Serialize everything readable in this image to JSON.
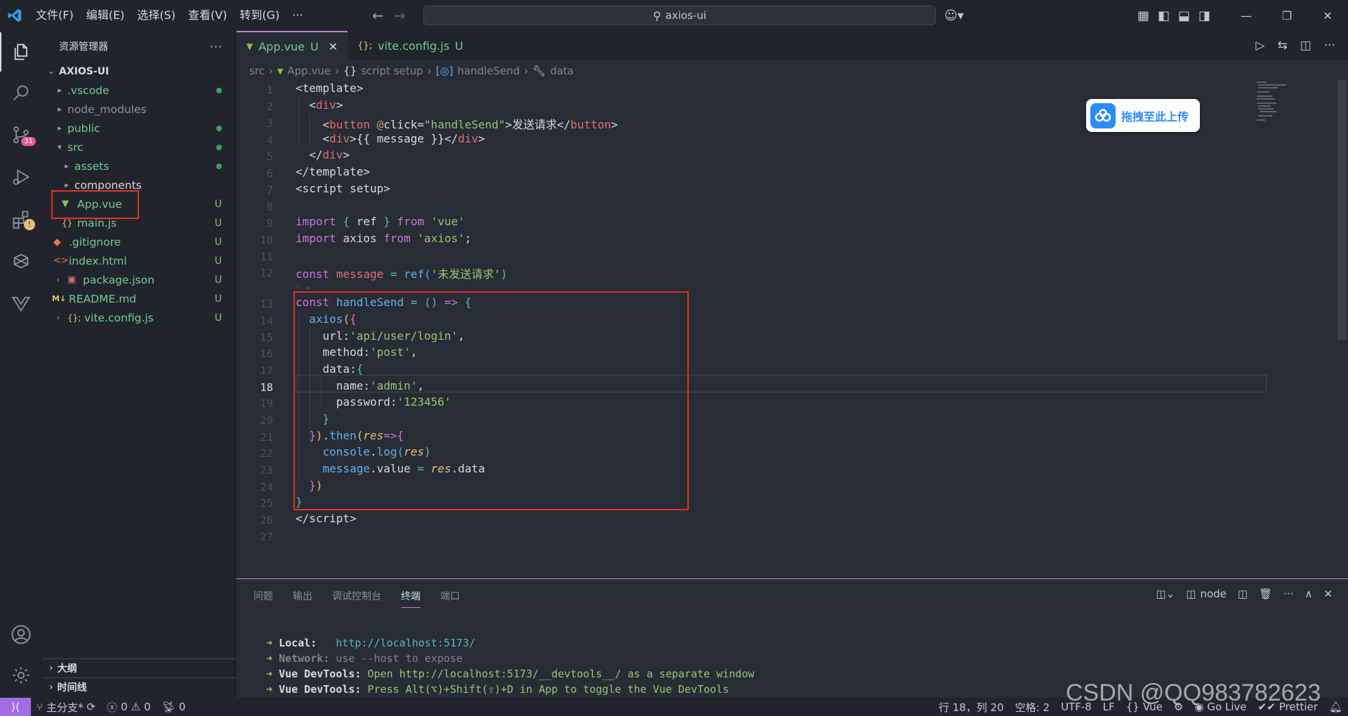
{
  "titlebar": {
    "menus": [
      "文件(F)",
      "编辑(E)",
      "选择(S)",
      "查看(V)",
      "转到(G)",
      "···"
    ],
    "search_text": "axios-ui"
  },
  "activity": {
    "source_control_badge": "31"
  },
  "sidebar": {
    "title": "资源管理器",
    "project": "AXIOS-UI",
    "items": [
      {
        "label": ".vscode",
        "status": "dot"
      },
      {
        "label": "node_modules",
        "status": ""
      },
      {
        "label": "public",
        "status": "dot"
      },
      {
        "label": "src",
        "status": "dot"
      },
      {
        "label": "assets",
        "status": "dot"
      },
      {
        "label": "components",
        "status": ""
      },
      {
        "label": "App.vue",
        "status": "U"
      },
      {
        "label": "main.js",
        "status": "U"
      },
      {
        "label": ".gitignore",
        "status": "U"
      },
      {
        "label": "index.html",
        "status": "U"
      },
      {
        "label": "package.json",
        "status": "U"
      },
      {
        "label": "README.md",
        "status": "U"
      },
      {
        "label": "vite.config.js",
        "status": "U"
      }
    ],
    "outline": "大纲",
    "timeline": "时间线"
  },
  "tabs": [
    {
      "label": "App.vue",
      "status": "U"
    },
    {
      "label": "vite.config.js",
      "status": "U"
    }
  ],
  "breadcrumb": [
    "src",
    "App.vue",
    "script setup",
    "handleSend",
    "data"
  ],
  "upload_badge": "拖拽至此上传",
  "editor": {
    "line_numbers": [
      "1",
      "2",
      "3",
      "4",
      "5",
      "6",
      "7",
      "8",
      "9",
      "10",
      "11",
      "12",
      "13",
      "14",
      "15",
      "16",
      "17",
      "18",
      "19",
      "20",
      "21",
      "22",
      "23",
      "24",
      "25",
      "26",
      "27"
    ],
    "current_line": "18"
  },
  "panel": {
    "tabs": [
      "问题",
      "输出",
      "调试控制台",
      "终端",
      "端口"
    ],
    "terminal_name": "node",
    "lines": [
      {
        "arrow": "➜",
        "label": "Local:",
        "text": "http://localhost:5173/"
      },
      {
        "arrow": "➜",
        "label": "Network:",
        "text": "use --host to expose"
      },
      {
        "arrow": "➜",
        "label": "Vue DevTools:",
        "text": "Open http://localhost:5173/__devtools__/ as a separate window"
      },
      {
        "arrow": "➜",
        "label": "Vue DevTools:",
        "text": "Press Alt(⌥)+Shift(⇧)+D in App to toggle the Vue DevTools"
      }
    ]
  },
  "status": {
    "branch": "主分支*",
    "errors": "0",
    "warnings": "0",
    "ports": "0",
    "position": "行 18，列 20",
    "spaces": "空格: 2",
    "encoding": "UTF-8",
    "eol": "LF",
    "language": "Vue",
    "golive": "Go Live",
    "prettier": "Prettier"
  },
  "watermark": "CSDN @QQ983782623",
  "colors": {
    "accent": "#c678dd",
    "highlight_box": "#e52e2e",
    "remote": "#a36ee3"
  }
}
